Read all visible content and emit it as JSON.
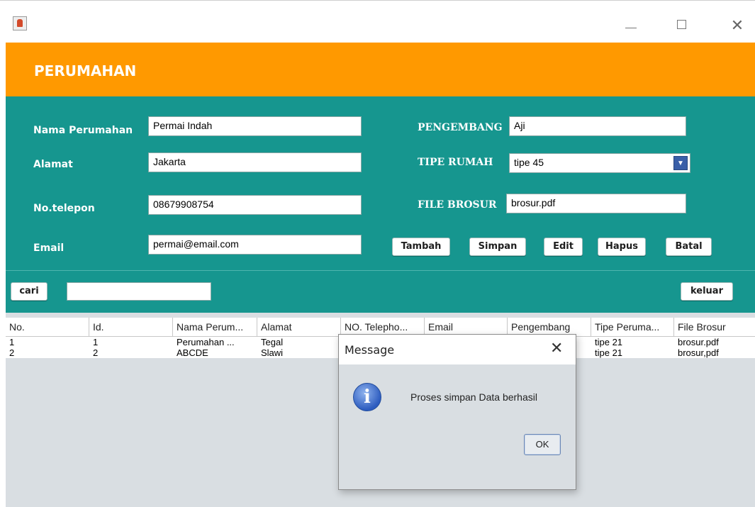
{
  "window": {
    "app_icon": "java-cup-icon",
    "minimize_icon": "minimize-icon",
    "maximize_icon": "maximize-icon",
    "close_glyph": "✕"
  },
  "header": {
    "title": "PERUMAHAN",
    "background": "#ff9900"
  },
  "form": {
    "background": "#16968f",
    "nama_label": "Nama Perumahan",
    "nama_value": "Permai Indah",
    "alamat_label": "Alamat",
    "alamat_value": "Jakarta",
    "telepon_label": "No.telepon",
    "telepon_value": "08679908754",
    "email_label": "Email",
    "email_value": "permai@email.com",
    "pengembang_label": "PENGEMBANG",
    "pengembang_value": "Aji",
    "tipe_label": "TIPE RUMAH",
    "tipe_value": "tipe 45",
    "brosur_label": "FILE BROSUR",
    "brosur_value": "brosur.pdf"
  },
  "buttons": {
    "tambah": "Tambah",
    "simpan": "Simpan",
    "edit": "Edit",
    "hapus": "Hapus",
    "batal": "Batal",
    "cari": "cari",
    "keluar": "keluar"
  },
  "search": {
    "value": ""
  },
  "table": {
    "columns": [
      "No.",
      "Id.",
      "Nama Perum...",
      "Alamat",
      "NO. Telepho...",
      "Email",
      "Pengembang",
      "Tipe Peruma...",
      "File Brosur"
    ],
    "rows": [
      [
        "1",
        "1",
        "Perumahan ...",
        "Tegal",
        "",
        "",
        "",
        "tipe 21",
        "brosur.pdf"
      ],
      [
        "2",
        "2",
        "ABCDE",
        "Slawi",
        "",
        "",
        "",
        "tipe 21",
        "brosur,pdf"
      ]
    ]
  },
  "dialog": {
    "title": "Message",
    "close_glyph": "✕",
    "icon": "info-icon",
    "icon_glyph": "i",
    "message": "Proses simpan Data berhasil",
    "ok_label": "OK"
  }
}
